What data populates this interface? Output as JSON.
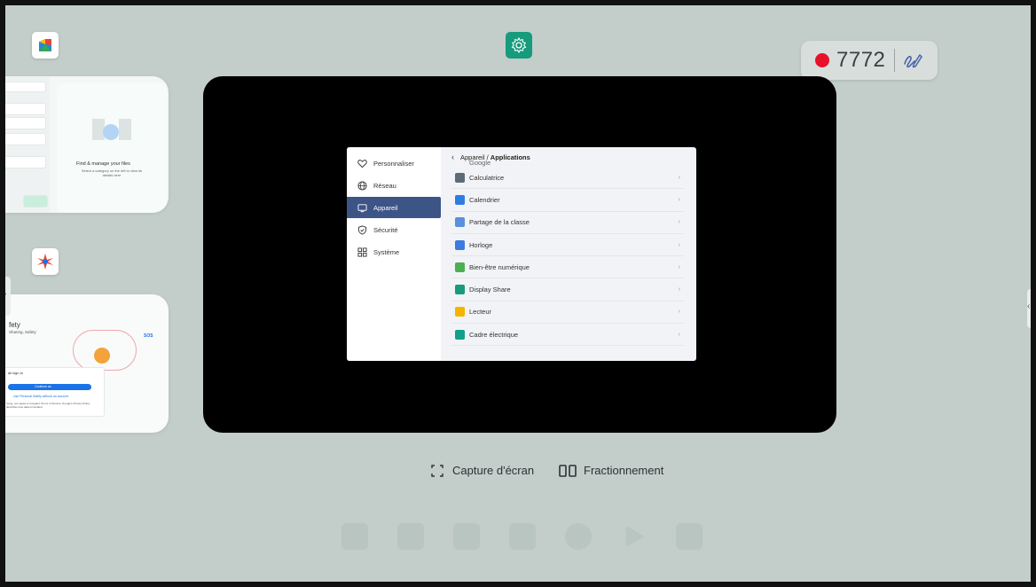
{
  "recording": {
    "count": "7772",
    "dot_color": "#e8102a"
  },
  "top_center_app": {
    "icon": "settings-gear-icon",
    "color": "#169b7c"
  },
  "left_apps": [
    {
      "icon": "files-app-icon"
    },
    {
      "icon": "personal-safety-app-icon"
    }
  ],
  "files_card": {
    "title": "Find & manage your files",
    "subtitle": "Select a category on the left to view its details here"
  },
  "safety_card": {
    "title": "fety",
    "subtitle": "Sharing, Safety",
    "sos": "SOS",
    "email_label": "ail sign-in",
    "continue_label": "Continue as ",
    "alt_label": "Use Personal Safety without an account",
    "terms": "nuing, you agree to Google's Terms of Service. Google's Privacy Policy describes how data is handled."
  },
  "settings": {
    "sidebar": [
      {
        "label": "Personnaliser",
        "icon": "heart-icon",
        "active": false
      },
      {
        "label": "Réseau",
        "icon": "globe-icon",
        "active": false
      },
      {
        "label": "Appareil",
        "icon": "monitor-icon",
        "active": true
      },
      {
        "label": "Sécurité",
        "icon": "shield-icon",
        "active": false
      },
      {
        "label": "Système",
        "icon": "grid-icon",
        "active": false
      }
    ],
    "breadcrumb": {
      "parent": "Appareil",
      "separator": " / ",
      "current": "Applications"
    },
    "partial_row": "Google",
    "apps": [
      {
        "label": "Calculatrice",
        "color": "#5b6b78"
      },
      {
        "label": "Calendrier",
        "color": "#2f7de1"
      },
      {
        "label": "Partage de la classe",
        "color": "#5a8fdc"
      },
      {
        "label": "Horloge",
        "color": "#3c7be0"
      },
      {
        "label": "Bien-être numérique",
        "color": "#4caf50"
      },
      {
        "label": "Display Share",
        "color": "#169b7c"
      },
      {
        "label": "Lecteur",
        "color": "#f4b400"
      },
      {
        "label": "Cadre électrique",
        "color": "#12a08a"
      }
    ]
  },
  "actions": {
    "screenshot": {
      "label": "Capture d'écran",
      "icon": "screenshot-frame-icon"
    },
    "split": {
      "label": "Fractionnement",
      "icon": "split-screen-icon"
    }
  }
}
